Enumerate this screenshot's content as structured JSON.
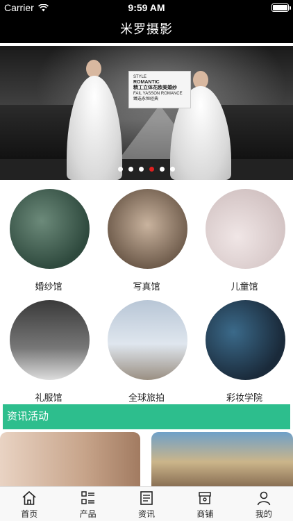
{
  "status_bar": {
    "carrier": "Carrier",
    "time": "9:59 AM"
  },
  "nav": {
    "title": "米罗摄影"
  },
  "banner": {
    "card": {
      "line1": "STYLE",
      "line2": "ROMANTIC",
      "line3": "精工立体花欧美婚纱",
      "line4": "FAIL YASSON ROMANCE",
      "line5": "臻选永恒经典"
    },
    "active_dot_color": "#e02020",
    "active_dot_index": 3,
    "dot_count": 6
  },
  "categories": [
    {
      "label": "婚纱馆"
    },
    {
      "label": "写真馆"
    },
    {
      "label": "儿童馆"
    },
    {
      "label": "礼服馆"
    },
    {
      "label": "全球旅拍"
    },
    {
      "label": "彩妆学院"
    }
  ],
  "news": {
    "header": "资讯活动",
    "header_color": "#2dbe8d"
  },
  "tabs": [
    {
      "label": "首页",
      "icon": "home-icon"
    },
    {
      "label": "产品",
      "icon": "grid-list-icon"
    },
    {
      "label": "资讯",
      "icon": "news-icon"
    },
    {
      "label": "商铺",
      "icon": "shop-icon"
    },
    {
      "label": "我的",
      "icon": "user-icon"
    }
  ]
}
